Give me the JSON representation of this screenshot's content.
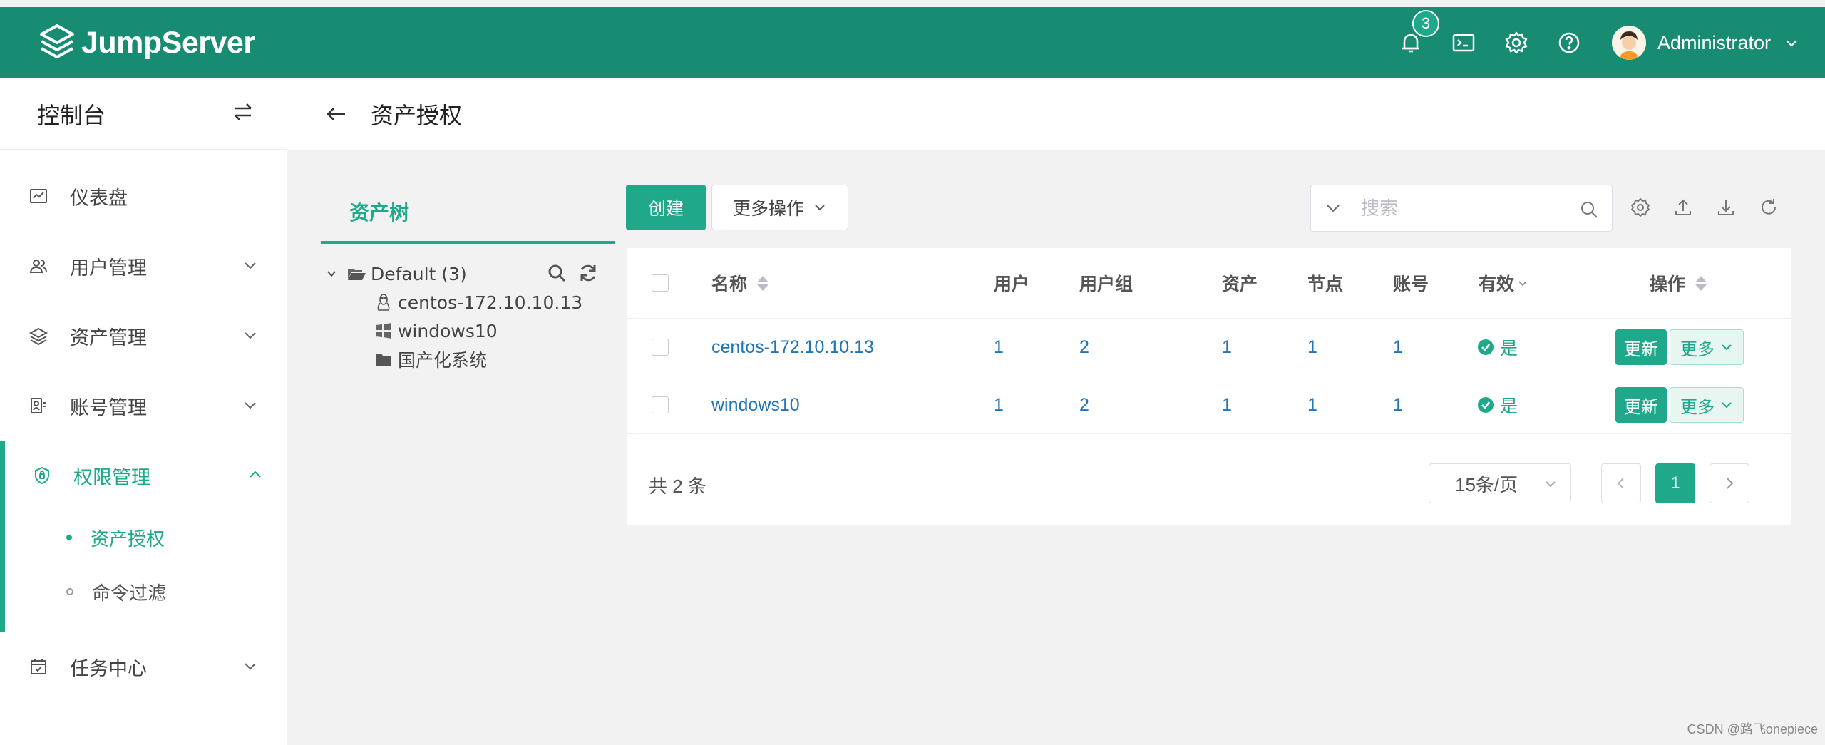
{
  "app": {
    "name": "JumpServer",
    "brand_color": "#188c72",
    "accent_color": "#1fa98a"
  },
  "topbar": {
    "notification_count": "3",
    "username": "Administrator"
  },
  "sidebar": {
    "title": "控制台",
    "items": [
      {
        "label": "仪表盘",
        "icon": "dashboard-icon"
      },
      {
        "label": "用户管理",
        "icon": "users-icon"
      },
      {
        "label": "资产管理",
        "icon": "assets-icon"
      },
      {
        "label": "账号管理",
        "icon": "accounts-icon"
      },
      {
        "label": "权限管理",
        "icon": "shield-icon",
        "expanded": true,
        "children": [
          {
            "label": "资产授权",
            "active": true
          },
          {
            "label": "命令过滤"
          }
        ]
      },
      {
        "label": "任务中心",
        "icon": "calendar-icon"
      }
    ]
  },
  "page": {
    "title": "资产授权"
  },
  "tree": {
    "tab_label": "资产树",
    "root_label": "Default (3)",
    "nodes": [
      {
        "label": "centos-172.10.10.13",
        "icon": "linux-icon"
      },
      {
        "label": "windows10",
        "icon": "windows-icon"
      },
      {
        "label": "国产化系统",
        "icon": "folder-icon"
      }
    ]
  },
  "toolbar": {
    "create_label": "创建",
    "more_ops_label": "更多操作",
    "search_placeholder": "搜索"
  },
  "table": {
    "columns": {
      "name": "名称",
      "users": "用户",
      "user_groups": "用户组",
      "assets": "资产",
      "nodes": "节点",
      "accounts": "账号",
      "valid": "有效",
      "actions": "操作"
    },
    "rows": [
      {
        "name": "centos-172.10.10.13",
        "users": "1",
        "user_groups": "2",
        "assets": "1",
        "nodes": "1",
        "accounts": "1",
        "valid": "是",
        "update": "更新",
        "more": "更多"
      },
      {
        "name": "windows10",
        "users": "1",
        "user_groups": "2",
        "assets": "1",
        "nodes": "1",
        "accounts": "1",
        "valid": "是",
        "update": "更新",
        "more": "更多"
      }
    ]
  },
  "pagination": {
    "total_text": "共 2 条",
    "page_size": "15条/页",
    "current_page": "1"
  },
  "watermark": "CSDN @路飞onepiece"
}
